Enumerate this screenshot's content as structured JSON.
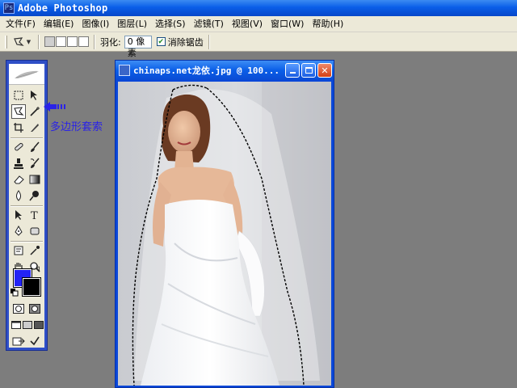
{
  "app": {
    "title": "Adobe Photoshop"
  },
  "menu": [
    "文件(F)",
    "编辑(E)",
    "图像(I)",
    "图层(L)",
    "选择(S)",
    "滤镜(T)",
    "视图(V)",
    "窗口(W)",
    "帮助(H)"
  ],
  "options": {
    "feather_label": "羽化:",
    "feather_value": "0 像素",
    "antialias_label": "消除锯齿",
    "antialias_checked": true
  },
  "toolbox": {
    "active_tool": "polygonal-lasso",
    "foreground_color": "#2323f5",
    "background_color": "#000000"
  },
  "annotation": {
    "label": "多边形套索",
    "color": "#2a22e8"
  },
  "document": {
    "title": "chinaps.net龙依.jpg @ 100..."
  },
  "colors": {
    "titlebar": "#0a5ee8",
    "workspace": "#7d7d7d",
    "chrome": "#ece9d8"
  }
}
